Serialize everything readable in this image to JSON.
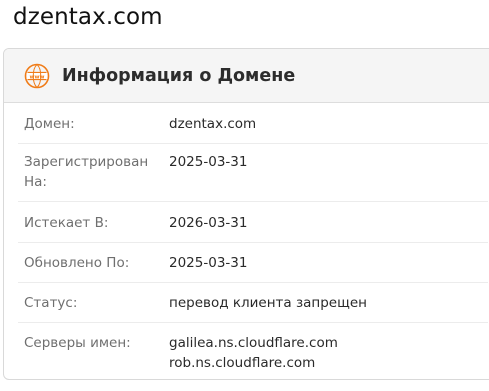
{
  "page": {
    "site_title": "dzentax.com"
  },
  "card": {
    "title": "Информация о Домене",
    "icon": "www-globe-icon",
    "accent_color": "#f07c18"
  },
  "rows": [
    {
      "label": "Домен:",
      "value": "dzentax.com"
    },
    {
      "label": "Зарегистрирован На:",
      "value": "2025-03-31"
    },
    {
      "label": "Истекает В:",
      "value": "2026-03-31"
    },
    {
      "label": "Обновлено По:",
      "value": "2025-03-31"
    },
    {
      "label": "Статус:",
      "value": "перевод клиента запрещен"
    },
    {
      "label": "Серверы имен:",
      "values": [
        "galilea.ns.cloudflare.com",
        "rob.ns.cloudflare.com"
      ]
    }
  ]
}
